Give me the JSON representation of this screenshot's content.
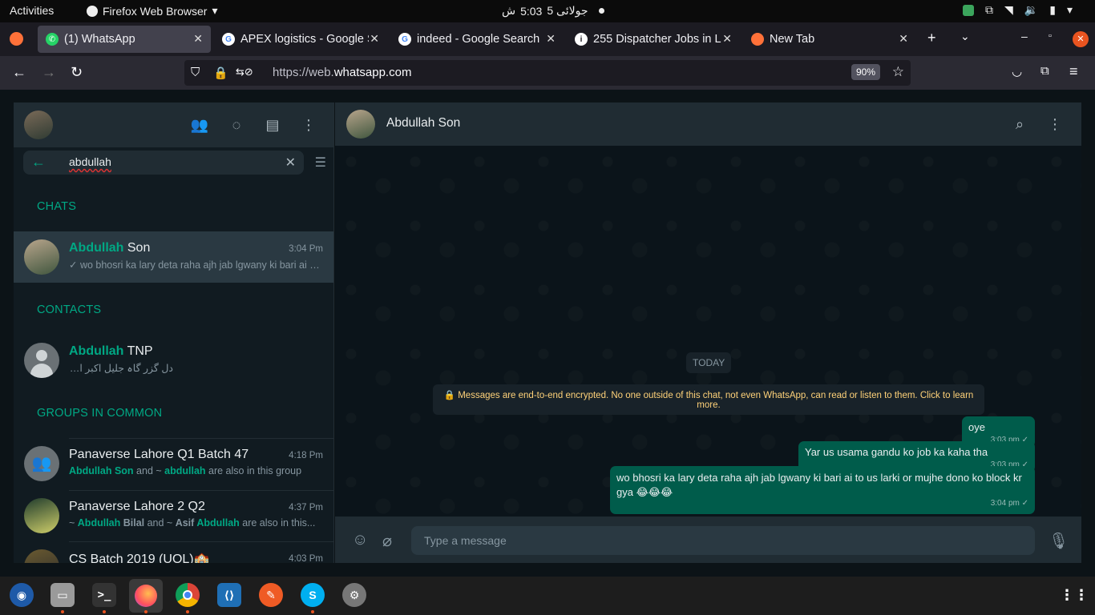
{
  "topbar": {
    "activities": "Activities",
    "app_name": "Firefox Web Browser",
    "clock_date": "جولائی 5",
    "clock_time": "5:03",
    "clock_suffix": "ش"
  },
  "tabs": [
    {
      "label": "(1) WhatsApp",
      "icon": "whatsapp-icon",
      "active": true
    },
    {
      "label": "APEX logistics - Google S",
      "icon": "google-icon"
    },
    {
      "label": "indeed - Google Search",
      "icon": "google-icon"
    },
    {
      "label": "255 Dispatcher Jobs in L",
      "icon": "info-icon"
    },
    {
      "label": "New Tab",
      "icon": "firefox-icon"
    }
  ],
  "navbar": {
    "url_prefix": "https://web.",
    "url_domain": "whatsapp.com",
    "zoom": "90%"
  },
  "sidebar": {
    "search_value": "abdullah",
    "sections": {
      "chats": "CHATS",
      "contacts": "CONTACTS",
      "groups": "GROUPS IN COMMON"
    },
    "chat_result": {
      "name_highlight": "Abdullah",
      "name_rest": " Son",
      "time": "3:04 Pm",
      "preview": "wo bhosri ka lary deta raha ajh jab lgwany ki bari ai to us larki or mujhe dono ko block kr gya"
    },
    "contact_result": {
      "name_highlight": "Abdullah",
      "name_rest": " TNP",
      "status": "دل گزر گاہ جلیل اکبر است"
    },
    "groups": [
      {
        "name": "Panaverse Lahore Q1 Batch 47",
        "time": "4:18 Pm",
        "sub_1": "Abdullah Son",
        "sub_2": " and ~ ",
        "sub_3": "abdullah",
        "sub_4": " are also in this group"
      },
      {
        "name": "Panaverse Lahore 2 Q2",
        "time": "4:37 Pm",
        "sub_1": "~ ",
        "sub_2": "Abdullah",
        "sub_3": " Bilal",
        "sub_4": " and ~ ",
        "sub_5": "Asif ",
        "sub_6": "Abdullah",
        "sub_7": " are also in this..."
      },
      {
        "name": "CS Batch 2019 (UOL)🏫",
        "time": "4:03 Pm"
      }
    ]
  },
  "chat": {
    "contact_name": "Abdullah Son",
    "date_chip": "TODAY",
    "encryption_note": "🔒 Messages are end-to-end encrypted. No one outside of this chat, not even WhatsApp, can read or listen to them. Click to learn more.",
    "messages": [
      {
        "text": "oye",
        "time": "3:03 pm ✓"
      },
      {
        "text": "Yar us usama gandu ko job ka kaha tha",
        "time": "3:03 pm ✓"
      },
      {
        "text": "wo bhosri ka lary deta raha ajh jab lgwany ki bari ai to us larki or mujhe dono ko block kr gya 😂😂😂",
        "time": "3:04 pm ✓"
      }
    ],
    "composer_placeholder": "Type a message"
  },
  "colors": {
    "accent": "#00a884",
    "outgoing_bubble": "#005c4b",
    "panel": "#202c33",
    "background": "#0b141a"
  }
}
